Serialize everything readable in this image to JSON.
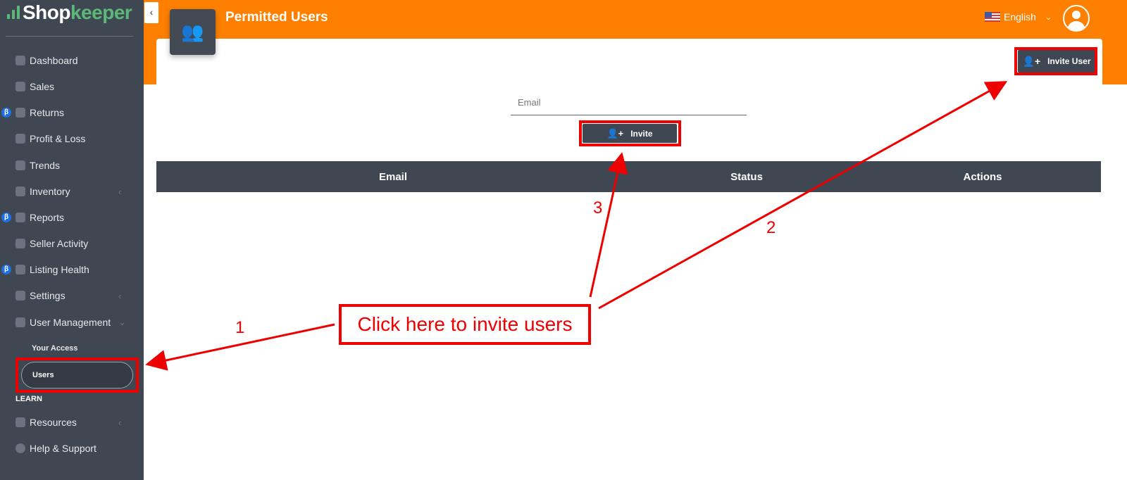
{
  "app": {
    "logo_part1": "Shop",
    "logo_part2": "keeper"
  },
  "sidebar": {
    "items": [
      {
        "label": "Dashboard",
        "icon": "dashboard-icon",
        "beta": false
      },
      {
        "label": "Sales",
        "icon": "cart-icon",
        "beta": false
      },
      {
        "label": "Returns",
        "icon": "return-icon",
        "beta": true
      },
      {
        "label": "Profit & Loss",
        "icon": "cart-icon",
        "beta": false
      },
      {
        "label": "Trends",
        "icon": "pie-chart-icon",
        "beta": false
      },
      {
        "label": "Inventory",
        "icon": "grid-icon",
        "beta": false,
        "chevron": "‹"
      },
      {
        "label": "Reports",
        "icon": "table-icon",
        "beta": true
      },
      {
        "label": "Seller Activity",
        "icon": "bag-icon",
        "beta": false
      },
      {
        "label": "Listing Health",
        "icon": "thermometer-icon",
        "beta": true
      },
      {
        "label": "Settings",
        "icon": "gear-icon",
        "beta": false,
        "chevron": "‹"
      },
      {
        "label": "User Management",
        "icon": "users-icon",
        "beta": false,
        "chevron": "⌄"
      }
    ],
    "beta_symbol": "β",
    "sub_items": [
      "Your Access",
      "Users"
    ],
    "section_learn": "LEARN",
    "learn_items": [
      {
        "label": "Resources",
        "icon": "apps-icon",
        "chevron": "‹"
      },
      {
        "label": "Help & Support",
        "icon": "chat-icon"
      }
    ]
  },
  "header": {
    "title": "Permitted Users",
    "language": "English",
    "collapse": "‹",
    "language_chevron": "⌄"
  },
  "main": {
    "invite_user_label": "Invite User",
    "email_placeholder": "Email",
    "invite_label": "Invite",
    "table": {
      "columns": [
        "Email",
        "Status",
        "Actions"
      ],
      "rows": []
    }
  },
  "annotations": {
    "callout": "Click here to invite users",
    "step1": "1",
    "step2": "2",
    "step3": "3",
    "color": "#e00000"
  },
  "colors": {
    "header": "#ff8000",
    "sidebar": "#3f4753",
    "accent_green": "#5cb879"
  }
}
